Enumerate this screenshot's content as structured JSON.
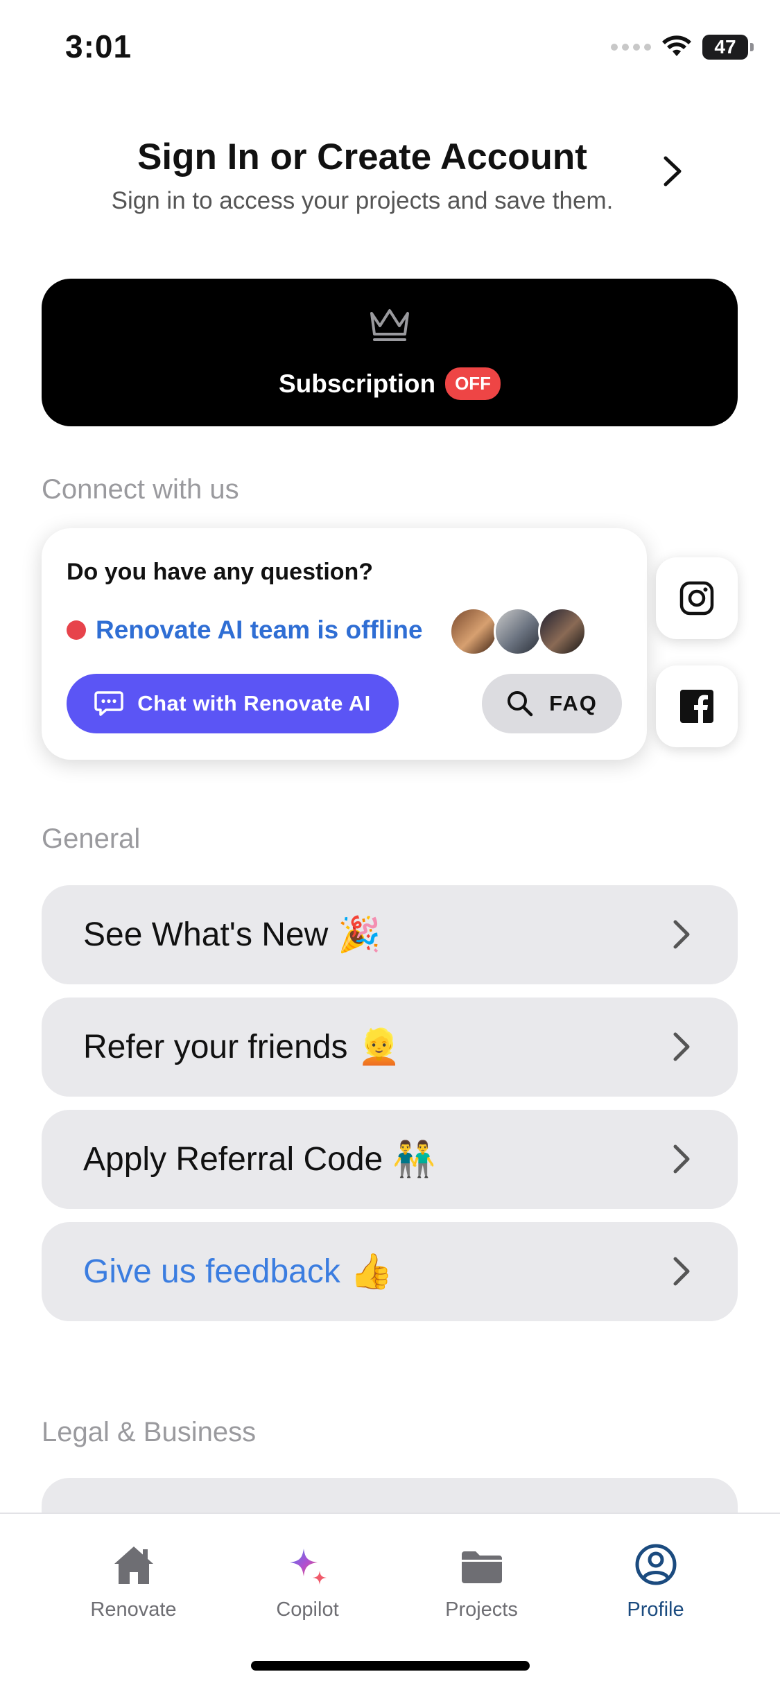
{
  "status_bar": {
    "time": "3:01",
    "battery": "47"
  },
  "header": {
    "title": "Sign In or Create Account",
    "subtitle": "Sign in to access your projects and save them."
  },
  "subscription": {
    "label": "Subscription",
    "badge": "OFF",
    "icon": "crown-icon"
  },
  "connect": {
    "section_title": "Connect with us",
    "question": "Do you have any question?",
    "status_text": "Renovate AI team is offline",
    "status_color": "#e7434b",
    "chat_button": "Chat with Renovate AI",
    "faq_button": "FAQ",
    "social": [
      "instagram-icon",
      "facebook-icon"
    ]
  },
  "general": {
    "section_title": "General",
    "items": [
      {
        "label": "See What's New",
        "emoji": "🎉"
      },
      {
        "label": "Refer your friends",
        "emoji": "👱"
      },
      {
        "label": "Apply Referral Code",
        "emoji": "👬"
      },
      {
        "label": "Give us feedback",
        "emoji": "👍"
      }
    ]
  },
  "legal": {
    "section_title": "Legal & Business"
  },
  "tabbar": {
    "tabs": [
      {
        "label": "Renovate",
        "icon": "house-icon"
      },
      {
        "label": "Copilot",
        "icon": "sparkle-icon"
      },
      {
        "label": "Projects",
        "icon": "folder-icon"
      },
      {
        "label": "Profile",
        "icon": "profile-icon"
      }
    ],
    "active": "Profile",
    "active_color": "#1b4b7f"
  },
  "colors": {
    "accent": "#5b55f5",
    "link_blue": "#2f6ed4",
    "badge_red": "#ee4545"
  }
}
